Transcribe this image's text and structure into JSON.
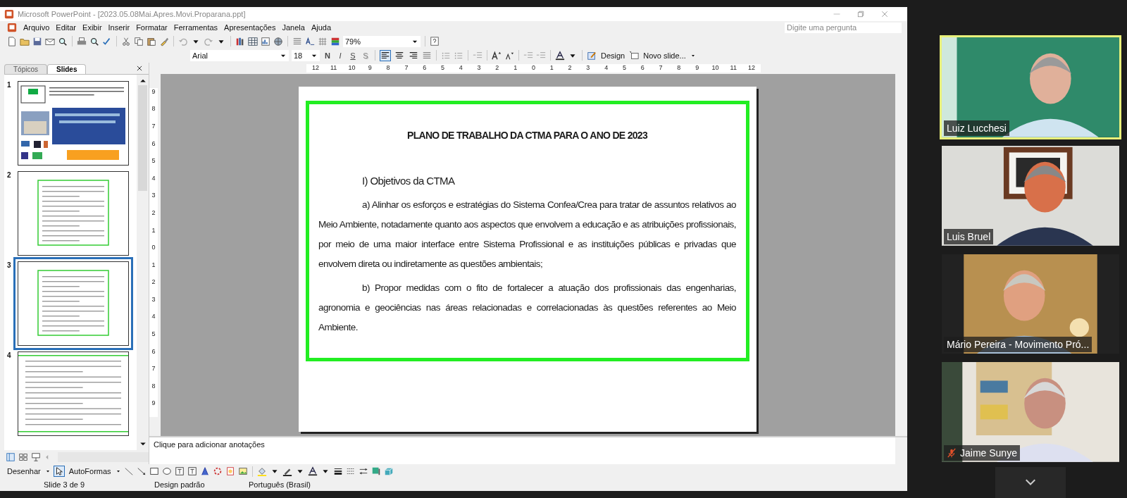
{
  "window": {
    "title": "Microsoft PowerPoint - [2023.05.08Mai.Apres.Movi.Proparana.ppt]"
  },
  "menu": [
    "Arquivo",
    "Editar",
    "Exibir",
    "Inserir",
    "Formatar",
    "Ferramentas",
    "Apresentações",
    "Janela",
    "Ajuda"
  ],
  "help_search": {
    "placeholder": "Digite uma pergunta"
  },
  "zoom": {
    "value": "79%"
  },
  "font": {
    "name": "Arial",
    "size": "18"
  },
  "format_buttons": [
    {
      "label": "N",
      "kind": "bold"
    },
    {
      "label": "I",
      "kind": "italic"
    },
    {
      "label": "S",
      "kind": "underline"
    },
    {
      "label": "S",
      "kind": "shadow"
    }
  ],
  "alignment_buttons": [
    {
      "kind": "left",
      "selected": true
    },
    {
      "kind": "center",
      "selected": false
    },
    {
      "kind": "right",
      "selected": false
    }
  ],
  "design_button": "Design",
  "new_slide_button": "Novo slide...",
  "ruler": {
    "horizontal": [
      "12",
      "11",
      "10",
      "9",
      "8",
      "7",
      "6",
      "5",
      "4",
      "3",
      "2",
      "1",
      "0",
      "1",
      "2",
      "3",
      "4",
      "5",
      "6",
      "7",
      "8",
      "9",
      "10",
      "11",
      "12"
    ],
    "vertical": [
      "9",
      "8",
      "7",
      "6",
      "5",
      "4",
      "3",
      "2",
      "1",
      "0",
      "1",
      "2",
      "3",
      "4",
      "5",
      "6",
      "7",
      "8",
      "9"
    ]
  },
  "panel": {
    "tabs": [
      {
        "label": "Tópicos",
        "selected": false
      },
      {
        "label": "Slides",
        "selected": true
      }
    ]
  },
  "slides": [
    {
      "number": "1",
      "kind": "cover",
      "selected": false
    },
    {
      "number": "2",
      "kind": "framed",
      "selected": false
    },
    {
      "number": "3",
      "kind": "framed",
      "selected": true
    },
    {
      "number": "4",
      "kind": "lined",
      "selected": false
    }
  ],
  "slide": {
    "title": "PLANO DE TRABALHO DA CTMA PARA O ANO DE 2023",
    "heading": "I) Objetivos da CTMA",
    "paragraphs": [
      "a) Alinhar os esforços e estratégias do Sistema Confea/Crea para tratar de assuntos relativos ao Meio Ambiente, notadamente quanto aos aspectos que envolvem a educação e as atribuições profissionais, por meio de uma maior interface entre Sistema Profissional e as instituições públicas e privadas que envolvem direta ou indiretamente as questões ambientais;",
      "b) Propor medidas com o fito de fortalecer a atuação dos profissionais das engenharias, agronomia e geociências nas áreas relacionadas e correlacionadas às questões referentes ao Meio Ambiente."
    ]
  },
  "notes": {
    "placeholder": "Clique para adicionar anotações"
  },
  "drawing_toolbar": {
    "draw_menu": "Desenhar",
    "autoshapes_menu": "AutoFormas"
  },
  "status_bar": [
    "Slide 3 de 9",
    "Design padrão",
    "Português (Brasil)"
  ],
  "participants": [
    {
      "name": "Luiz Lucchesi",
      "speaking": true,
      "muted": false
    },
    {
      "name": "Luis Bruel",
      "speaking": false,
      "muted": false
    },
    {
      "name": "Mário Pereira - Movimento Pró...",
      "speaking": false,
      "muted": false
    },
    {
      "name": "Jaime Sunye",
      "speaking": false,
      "muted": true
    }
  ]
}
